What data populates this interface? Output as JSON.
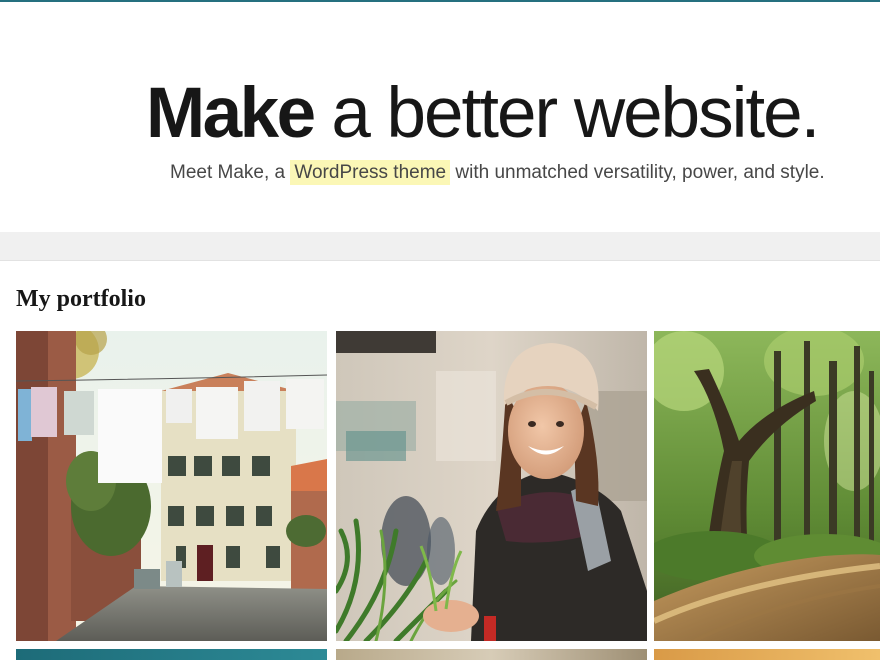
{
  "hero": {
    "title_strong": "Make",
    "title_rest": " a better website.",
    "subtitle_before": "Meet Make, a ",
    "subtitle_highlight": "WordPress theme",
    "subtitle_after": " with unmatched versatility, power, and style."
  },
  "portfolio": {
    "heading": "My portfolio",
    "items": [
      {
        "name": "laundry-street-photo",
        "subject": "Laundry hanging over a street"
      },
      {
        "name": "smiling-woman-photo",
        "subject": "Smiling woman in a knit hat"
      },
      {
        "name": "forest-path-photo",
        "subject": "Forest path with trees"
      }
    ]
  },
  "colors": {
    "accent": "#25707f",
    "highlight": "#fbf7b6",
    "text": "#171717",
    "band": "#f0f0f0"
  }
}
